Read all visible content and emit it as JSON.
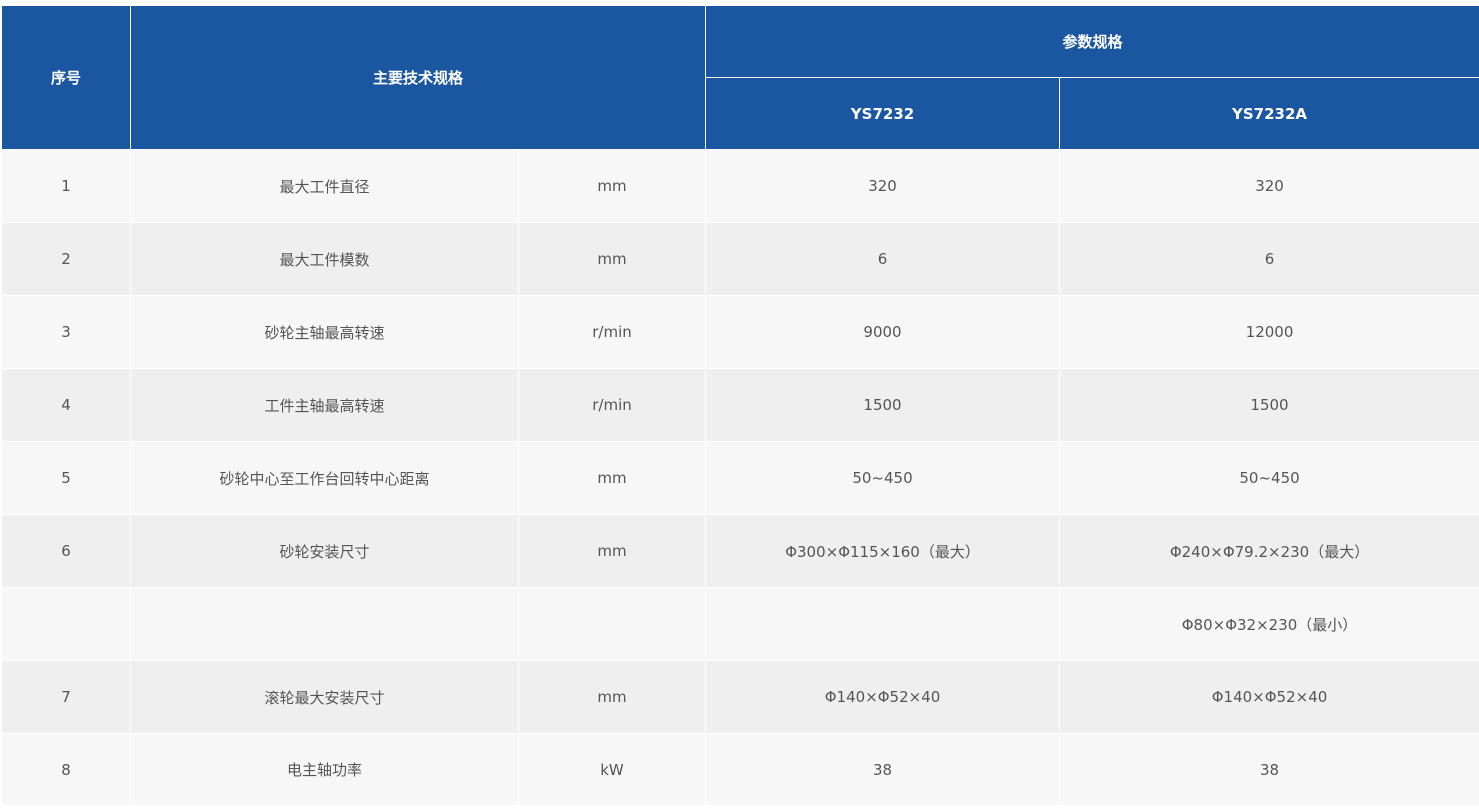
{
  "header": {
    "index": "序号",
    "main_spec": "主要技术规格",
    "params": "参数规格",
    "model_a": "YS7232",
    "model_b": "YS7232A"
  },
  "rows": [
    {
      "index": "1",
      "name": "最大工件直径",
      "unit": "mm",
      "a": "320",
      "b": "320"
    },
    {
      "index": "2",
      "name": "最大工件模数",
      "unit": "mm",
      "a": "6",
      "b": "6"
    },
    {
      "index": "3",
      "name": "砂轮主轴最高转速",
      "unit": "r/min",
      "a": "9000",
      "b": "12000"
    },
    {
      "index": "4",
      "name": "工件主轴最高转速",
      "unit": "r/min",
      "a": "1500",
      "b": "1500"
    },
    {
      "index": "5",
      "name": "砂轮中心至工作台回转中心距离",
      "unit": "mm",
      "a": "50~450",
      "b": "50~450"
    },
    {
      "index": "6",
      "name": "砂轮安装尺寸",
      "unit": "mm",
      "a": "Φ300×Φ115×160（最大）",
      "b": "Φ240×Φ79.2×230（最大）"
    },
    {
      "index": "",
      "name": "",
      "unit": "",
      "a": "",
      "b": "Φ80×Φ32×230（最小）"
    },
    {
      "index": "7",
      "name": "滚轮最大安装尺寸",
      "unit": "mm",
      "a": "Φ140×Φ52×40",
      "b": "Φ140×Φ52×40"
    },
    {
      "index": "8",
      "name": "电主轴功率",
      "unit": "kW",
      "a": "38",
      "b": "38"
    }
  ]
}
